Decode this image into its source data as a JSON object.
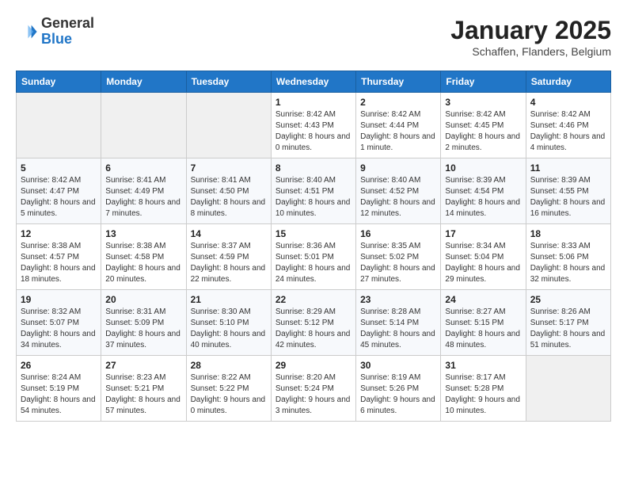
{
  "header": {
    "logo_general": "General",
    "logo_blue": "Blue",
    "month_year": "January 2025",
    "location": "Schaffen, Flanders, Belgium"
  },
  "days_of_week": [
    "Sunday",
    "Monday",
    "Tuesday",
    "Wednesday",
    "Thursday",
    "Friday",
    "Saturday"
  ],
  "weeks": [
    [
      {
        "day": "",
        "info": ""
      },
      {
        "day": "",
        "info": ""
      },
      {
        "day": "",
        "info": ""
      },
      {
        "day": "1",
        "info": "Sunrise: 8:42 AM\nSunset: 4:43 PM\nDaylight: 8 hours and 0 minutes."
      },
      {
        "day": "2",
        "info": "Sunrise: 8:42 AM\nSunset: 4:44 PM\nDaylight: 8 hours and 1 minute."
      },
      {
        "day": "3",
        "info": "Sunrise: 8:42 AM\nSunset: 4:45 PM\nDaylight: 8 hours and 2 minutes."
      },
      {
        "day": "4",
        "info": "Sunrise: 8:42 AM\nSunset: 4:46 PM\nDaylight: 8 hours and 4 minutes."
      }
    ],
    [
      {
        "day": "5",
        "info": "Sunrise: 8:42 AM\nSunset: 4:47 PM\nDaylight: 8 hours and 5 minutes."
      },
      {
        "day": "6",
        "info": "Sunrise: 8:41 AM\nSunset: 4:49 PM\nDaylight: 8 hours and 7 minutes."
      },
      {
        "day": "7",
        "info": "Sunrise: 8:41 AM\nSunset: 4:50 PM\nDaylight: 8 hours and 8 minutes."
      },
      {
        "day": "8",
        "info": "Sunrise: 8:40 AM\nSunset: 4:51 PM\nDaylight: 8 hours and 10 minutes."
      },
      {
        "day": "9",
        "info": "Sunrise: 8:40 AM\nSunset: 4:52 PM\nDaylight: 8 hours and 12 minutes."
      },
      {
        "day": "10",
        "info": "Sunrise: 8:39 AM\nSunset: 4:54 PM\nDaylight: 8 hours and 14 minutes."
      },
      {
        "day": "11",
        "info": "Sunrise: 8:39 AM\nSunset: 4:55 PM\nDaylight: 8 hours and 16 minutes."
      }
    ],
    [
      {
        "day": "12",
        "info": "Sunrise: 8:38 AM\nSunset: 4:57 PM\nDaylight: 8 hours and 18 minutes."
      },
      {
        "day": "13",
        "info": "Sunrise: 8:38 AM\nSunset: 4:58 PM\nDaylight: 8 hours and 20 minutes."
      },
      {
        "day": "14",
        "info": "Sunrise: 8:37 AM\nSunset: 4:59 PM\nDaylight: 8 hours and 22 minutes."
      },
      {
        "day": "15",
        "info": "Sunrise: 8:36 AM\nSunset: 5:01 PM\nDaylight: 8 hours and 24 minutes."
      },
      {
        "day": "16",
        "info": "Sunrise: 8:35 AM\nSunset: 5:02 PM\nDaylight: 8 hours and 27 minutes."
      },
      {
        "day": "17",
        "info": "Sunrise: 8:34 AM\nSunset: 5:04 PM\nDaylight: 8 hours and 29 minutes."
      },
      {
        "day": "18",
        "info": "Sunrise: 8:33 AM\nSunset: 5:06 PM\nDaylight: 8 hours and 32 minutes."
      }
    ],
    [
      {
        "day": "19",
        "info": "Sunrise: 8:32 AM\nSunset: 5:07 PM\nDaylight: 8 hours and 34 minutes."
      },
      {
        "day": "20",
        "info": "Sunrise: 8:31 AM\nSunset: 5:09 PM\nDaylight: 8 hours and 37 minutes."
      },
      {
        "day": "21",
        "info": "Sunrise: 8:30 AM\nSunset: 5:10 PM\nDaylight: 8 hours and 40 minutes."
      },
      {
        "day": "22",
        "info": "Sunrise: 8:29 AM\nSunset: 5:12 PM\nDaylight: 8 hours and 42 minutes."
      },
      {
        "day": "23",
        "info": "Sunrise: 8:28 AM\nSunset: 5:14 PM\nDaylight: 8 hours and 45 minutes."
      },
      {
        "day": "24",
        "info": "Sunrise: 8:27 AM\nSunset: 5:15 PM\nDaylight: 8 hours and 48 minutes."
      },
      {
        "day": "25",
        "info": "Sunrise: 8:26 AM\nSunset: 5:17 PM\nDaylight: 8 hours and 51 minutes."
      }
    ],
    [
      {
        "day": "26",
        "info": "Sunrise: 8:24 AM\nSunset: 5:19 PM\nDaylight: 8 hours and 54 minutes."
      },
      {
        "day": "27",
        "info": "Sunrise: 8:23 AM\nSunset: 5:21 PM\nDaylight: 8 hours and 57 minutes."
      },
      {
        "day": "28",
        "info": "Sunrise: 8:22 AM\nSunset: 5:22 PM\nDaylight: 9 hours and 0 minutes."
      },
      {
        "day": "29",
        "info": "Sunrise: 8:20 AM\nSunset: 5:24 PM\nDaylight: 9 hours and 3 minutes."
      },
      {
        "day": "30",
        "info": "Sunrise: 8:19 AM\nSunset: 5:26 PM\nDaylight: 9 hours and 6 minutes."
      },
      {
        "day": "31",
        "info": "Sunrise: 8:17 AM\nSunset: 5:28 PM\nDaylight: 9 hours and 10 minutes."
      },
      {
        "day": "",
        "info": ""
      }
    ]
  ]
}
